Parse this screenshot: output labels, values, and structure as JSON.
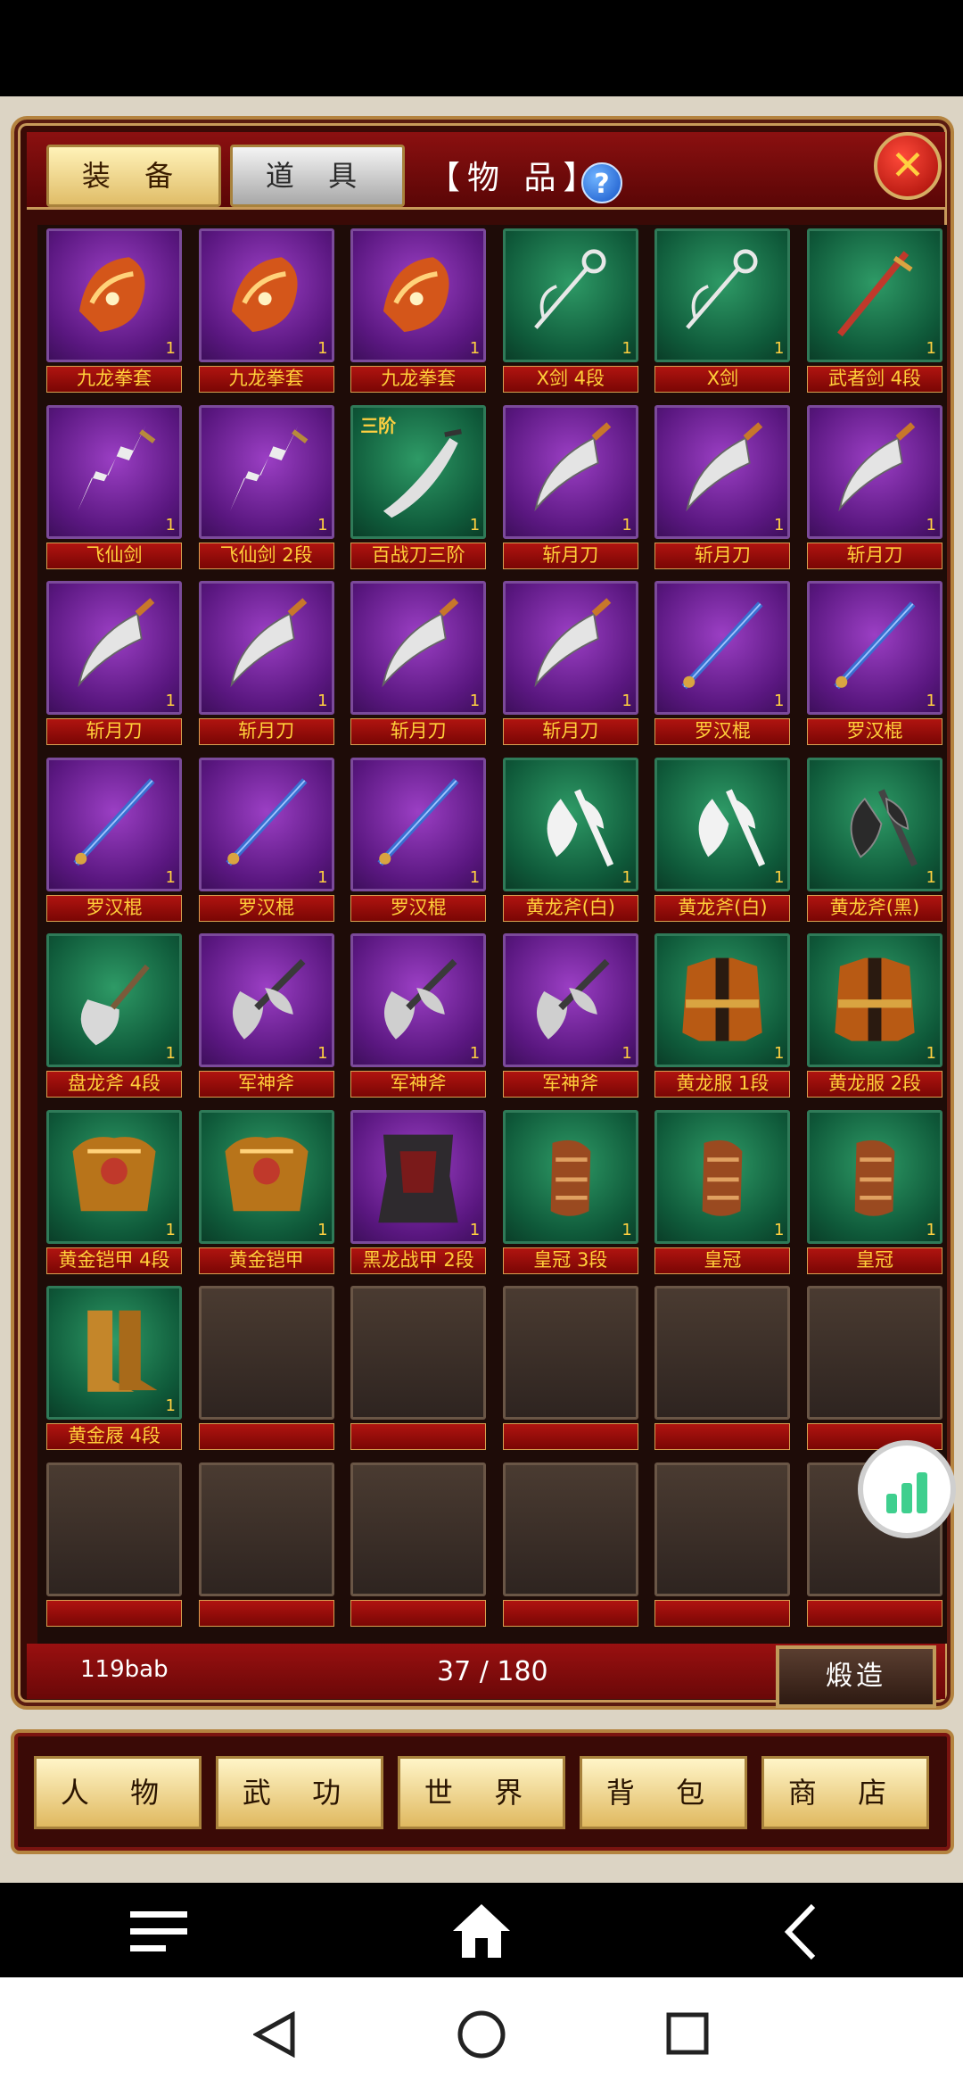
{
  "tabs": {
    "equipment": "装 备",
    "items": "道 具"
  },
  "title": "【物 品】",
  "help_label": "?",
  "close_label": "✕",
  "inventory": [
    {
      "name": "九龙拳套",
      "rarity": "purple",
      "count": "1",
      "icon": "gauntlet-icon",
      "tier": ""
    },
    {
      "name": "九龙拳套",
      "rarity": "purple",
      "count": "1",
      "icon": "gauntlet-icon",
      "tier": ""
    },
    {
      "name": "九龙拳套",
      "rarity": "purple",
      "count": "1",
      "icon": "gauntlet-icon",
      "tier": ""
    },
    {
      "name": "X剑 4段",
      "rarity": "green",
      "count": "1",
      "icon": "hook-sword-icon",
      "tier": ""
    },
    {
      "name": "X剑",
      "rarity": "green",
      "count": "1",
      "icon": "hook-sword-icon",
      "tier": ""
    },
    {
      "name": "武者剑 4段",
      "rarity": "green",
      "count": "1",
      "icon": "sword-icon",
      "tier": ""
    },
    {
      "name": "飞仙剑",
      "rarity": "purple",
      "count": "1",
      "icon": "lightning-sword-icon",
      "tier": ""
    },
    {
      "name": "飞仙剑 2段",
      "rarity": "purple",
      "count": "1",
      "icon": "lightning-sword-icon",
      "tier": ""
    },
    {
      "name": "百战刀三阶",
      "rarity": "green",
      "count": "1",
      "icon": "broadsword-icon",
      "tier": "三阶"
    },
    {
      "name": "斩月刀",
      "rarity": "purple",
      "count": "1",
      "icon": "crescent-blade-icon",
      "tier": ""
    },
    {
      "name": "斩月刀",
      "rarity": "purple",
      "count": "1",
      "icon": "crescent-blade-icon",
      "tier": ""
    },
    {
      "name": "斩月刀",
      "rarity": "purple",
      "count": "1",
      "icon": "crescent-blade-icon",
      "tier": ""
    },
    {
      "name": "斩月刀",
      "rarity": "purple",
      "count": "1",
      "icon": "crescent-blade-icon",
      "tier": ""
    },
    {
      "name": "斩月刀",
      "rarity": "purple",
      "count": "1",
      "icon": "crescent-blade-icon",
      "tier": ""
    },
    {
      "name": "斩月刀",
      "rarity": "purple",
      "count": "1",
      "icon": "crescent-blade-icon",
      "tier": ""
    },
    {
      "name": "斩月刀",
      "rarity": "purple",
      "count": "1",
      "icon": "crescent-blade-icon",
      "tier": ""
    },
    {
      "name": "罗汉棍",
      "rarity": "purple",
      "count": "1",
      "icon": "staff-icon",
      "tier": ""
    },
    {
      "name": "罗汉棍",
      "rarity": "purple",
      "count": "1",
      "icon": "staff-icon",
      "tier": ""
    },
    {
      "name": "罗汉棍",
      "rarity": "purple",
      "count": "1",
      "icon": "staff-icon",
      "tier": ""
    },
    {
      "name": "罗汉棍",
      "rarity": "purple",
      "count": "1",
      "icon": "staff-icon",
      "tier": ""
    },
    {
      "name": "罗汉棍",
      "rarity": "purple",
      "count": "1",
      "icon": "staff-icon",
      "tier": ""
    },
    {
      "name": "黄龙斧(白)",
      "rarity": "green",
      "count": "1",
      "icon": "axe-white-icon",
      "tier": ""
    },
    {
      "name": "黄龙斧(白)",
      "rarity": "green",
      "count": "1",
      "icon": "axe-white-icon",
      "tier": ""
    },
    {
      "name": "黄龙斧(黑)",
      "rarity": "green",
      "count": "1",
      "icon": "axe-black-icon",
      "tier": ""
    },
    {
      "name": "盘龙斧 4段",
      "rarity": "green",
      "count": "1",
      "icon": "dragon-axe-icon",
      "tier": ""
    },
    {
      "name": "军神斧",
      "rarity": "purple",
      "count": "1",
      "icon": "battle-axe-icon",
      "tier": ""
    },
    {
      "name": "军神斧",
      "rarity": "purple",
      "count": "1",
      "icon": "battle-axe-icon",
      "tier": ""
    },
    {
      "name": "军神斧",
      "rarity": "purple",
      "count": "1",
      "icon": "battle-axe-icon",
      "tier": ""
    },
    {
      "name": "黄龙服 1段",
      "rarity": "green",
      "count": "1",
      "icon": "robe-icon",
      "tier": ""
    },
    {
      "name": "黄龙服 2段",
      "rarity": "green",
      "count": "1",
      "icon": "robe-icon",
      "tier": ""
    },
    {
      "name": "黄金铠甲 4段",
      "rarity": "green",
      "count": "1",
      "icon": "gold-armor-icon",
      "tier": ""
    },
    {
      "name": "黄金铠甲",
      "rarity": "green",
      "count": "1",
      "icon": "gold-armor-icon",
      "tier": ""
    },
    {
      "name": "黑龙战甲 2段",
      "rarity": "purple",
      "count": "1",
      "icon": "dark-armor-icon",
      "tier": ""
    },
    {
      "name": "皇冠 3段",
      "rarity": "green",
      "count": "1",
      "icon": "bracer-icon",
      "tier": ""
    },
    {
      "name": "皇冠",
      "rarity": "green",
      "count": "1",
      "icon": "bracer-icon",
      "tier": ""
    },
    {
      "name": "皇冠",
      "rarity": "green",
      "count": "1",
      "icon": "bracer-icon",
      "tier": ""
    },
    {
      "name": "黄金屐 4段",
      "rarity": "green",
      "count": "1",
      "icon": "boots-icon",
      "tier": ""
    }
  ],
  "empty_slots": 11,
  "footer": {
    "player_name": "119bab",
    "capacity": "37 / 180",
    "forge_label": "煅造"
  },
  "nav": [
    "人 物",
    "武 功",
    "世 界",
    "背 包",
    "商 店"
  ],
  "colors": {
    "purple_slot": "#5a1780",
    "green_slot": "#0f5a3a",
    "label_text": "#ffcf3a",
    "frame": "#b4833f"
  }
}
